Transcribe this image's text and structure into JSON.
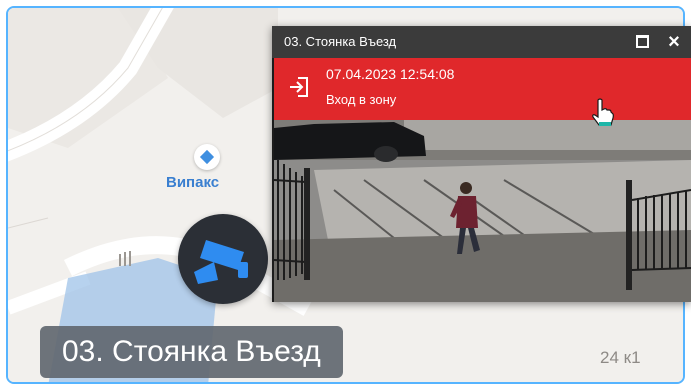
{
  "map": {
    "poi": {
      "name": "Випакс",
      "icon": "diamond-pin-icon"
    },
    "house_number": "24 к1",
    "camera_marker_icon": "security-camera-icon",
    "selected_place_label": "03. Стоянка Въезд",
    "colors": {
      "accent_border": "#56b4ff",
      "poi_text": "#3a7fd0",
      "marker_bg": "#2b2f36",
      "camera_icon": "#2f8cf0"
    }
  },
  "popup": {
    "title": "03. Стоянка Въезд",
    "maximize_icon": "maximize-icon",
    "close_icon": "close-icon",
    "close_glyph": "×",
    "alert": {
      "timestamp": "07.04.2023 12:54:08",
      "event": "Вход в зону",
      "icon": "enter-zone-icon",
      "color": "#e0282b"
    },
    "video_feed": {
      "description_icon": "camera-feed"
    }
  }
}
